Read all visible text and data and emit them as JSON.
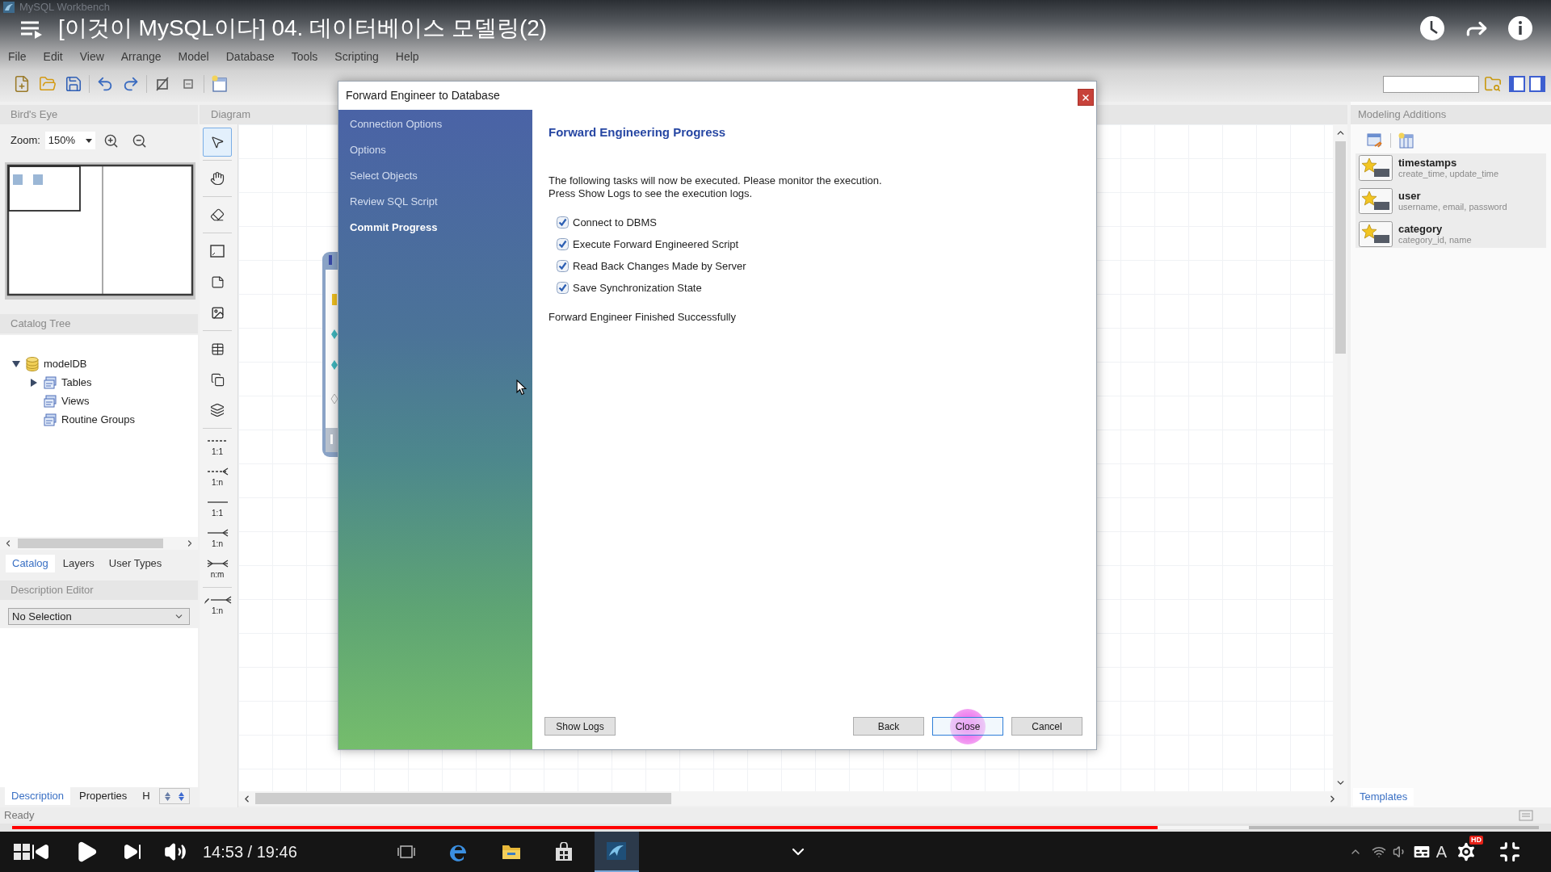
{
  "window": {
    "title": "MySQL Workbench"
  },
  "player": {
    "title": "[이것이 MySQL이다] 04. 데이터베이스 모델링(2)",
    "time": "14:53 / 19:46",
    "level": 0.75,
    "buffer": {
      "level": 0.81
    },
    "hd_badge": "HD"
  },
  "menu": [
    "File",
    "Edit",
    "View",
    "Arrange",
    "Model",
    "Database",
    "Tools",
    "Scripting",
    "Help"
  ],
  "birds_eye": {
    "title": "Bird's Eye",
    "zoom_label": "Zoom:",
    "zoom": "150%"
  },
  "catalog": {
    "title": "Catalog Tree",
    "tree": [
      {
        "label": "modelDB",
        "kind": "schema",
        "expanded": true,
        "children": [
          {
            "label": "Tables",
            "kind": "group",
            "expanded": false
          },
          {
            "label": "Views",
            "kind": "group"
          },
          {
            "label": "Routine Groups",
            "kind": "group"
          }
        ]
      }
    ],
    "tabs": [
      {
        "label": "Catalog",
        "selected": true
      },
      {
        "label": "Layers",
        "selected": false
      },
      {
        "label": "User Types",
        "selected": false
      }
    ]
  },
  "description_editor": {
    "title": "Description Editor",
    "select": "No Selection"
  },
  "bottom_tabs": [
    {
      "label": "Description",
      "selected": true
    },
    {
      "label": "Properties",
      "selected": false
    },
    {
      "label": "H",
      "selected": false
    }
  ],
  "diagram": {
    "title": "Diagram",
    "tool_groups": [
      {
        "tools": [
          {
            "kind": "pointer",
            "selected": true
          }
        ]
      },
      {
        "tools": [
          {
            "kind": "hand",
            "selected": false
          }
        ]
      },
      {
        "tools": [
          {
            "kind": "eraser",
            "selected": false
          }
        ]
      },
      {
        "tools": [
          {
            "kind": "layer",
            "selected": false
          },
          {
            "kind": "note",
            "selected": false
          },
          {
            "kind": "image",
            "selected": false
          }
        ]
      },
      {
        "tools": [
          {
            "kind": "table",
            "selected": false
          },
          {
            "kind": "view",
            "selected": false
          },
          {
            "kind": "routines",
            "selected": false
          }
        ]
      },
      {
        "tools": [
          {
            "kind": "relation",
            "label": "1:1",
            "dashed": true,
            "foot_right": false,
            "foot_left": false,
            "selected": false
          },
          {
            "kind": "relation",
            "label": "1:n",
            "dashed": true,
            "foot_right": true,
            "foot_left": false,
            "selected": false
          },
          {
            "kind": "relation",
            "label": "1:1",
            "dashed": false,
            "foot_right": false,
            "foot_left": false,
            "selected": false
          },
          {
            "kind": "relation",
            "label": "1:n",
            "dashed": false,
            "foot_right": true,
            "foot_left": false,
            "selected": false
          },
          {
            "kind": "relation",
            "label": "n:m",
            "dashed": false,
            "foot_right": true,
            "foot_left": true,
            "selected": false
          }
        ]
      },
      {
        "tools": [
          {
            "kind": "pick",
            "label": "1:n",
            "dashed": false,
            "foot_right": true,
            "foot_left": false,
            "selected": false
          }
        ]
      }
    ]
  },
  "modeling_additions": {
    "title": "Modeling Additions",
    "items": [
      {
        "name": "timestamps",
        "columns": "create_time, update_time"
      },
      {
        "name": "user",
        "columns": "username, email, password"
      },
      {
        "name": "category",
        "columns": "category_id, name"
      }
    ],
    "tabs": [
      {
        "label": "Templates",
        "selected": true
      }
    ]
  },
  "dialog": {
    "title": "Forward Engineer to Database",
    "steps": [
      {
        "label": "Connection Options",
        "selected": false
      },
      {
        "label": "Options",
        "selected": false
      },
      {
        "label": "Select Objects",
        "selected": false
      },
      {
        "label": "Review SQL Script",
        "selected": false
      },
      {
        "label": "Commit Progress",
        "selected": true
      }
    ],
    "heading": "Forward Engineering Progress",
    "intro": "The following tasks will now be executed. Please monitor the execution.\nPress Show Logs to see the execution logs.",
    "tasks": [
      {
        "label": "Connect to DBMS",
        "checked": true
      },
      {
        "label": "Execute Forward Engineered Script",
        "checked": true
      },
      {
        "label": "Read Back Changes Made by Server",
        "checked": true
      },
      {
        "label": "Save Synchronization State",
        "checked": true
      }
    ],
    "result": "Forward Engineer Finished Successfully",
    "side_buttons": [
      {
        "label": "Show Logs",
        "focused": false,
        "clicked": false
      }
    ],
    "buttons": [
      {
        "label": "Back",
        "focused": false,
        "clicked": false
      },
      {
        "label": "Close",
        "focused": true,
        "clicked": true
      },
      {
        "label": "Cancel",
        "focused": false,
        "clicked": false
      }
    ]
  },
  "status_bar": {
    "text": "Ready"
  },
  "taskbar": {
    "apps": [
      {
        "kind": "taskview",
        "selected": false
      },
      {
        "kind": "edge",
        "selected": false
      },
      {
        "kind": "explorer",
        "selected": false
      },
      {
        "kind": "store",
        "selected": false
      },
      {
        "kind": "workbench",
        "selected": true
      }
    ],
    "ime": "A"
  }
}
